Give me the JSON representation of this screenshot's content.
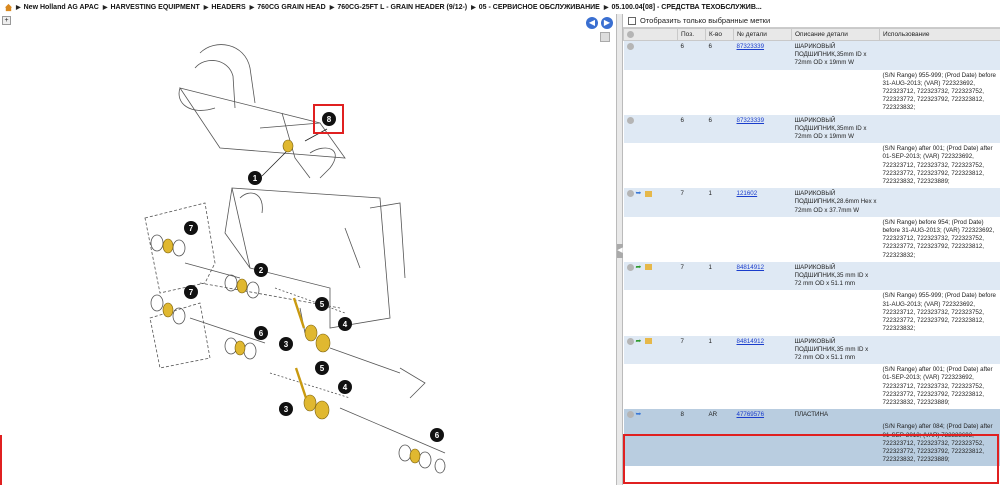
{
  "breadcrumb": [
    "New Holland AG APAC",
    "HARVESTING EQUIPMENT",
    "HEADERS",
    "760CG GRAIN HEAD",
    "760CG-25FT L - GRAIN HEADER (9/12-)",
    "05 - СЕРВИСНОЕ ОБСЛУЖИВАНИЕ",
    "05.100.04[08] - СРЕДСТВА ТЕХОБСЛУЖИВ..."
  ],
  "filter": {
    "label": "Отобразить только выбранные метки"
  },
  "table": {
    "headers": [
      "",
      "Поз.",
      "К-во",
      "№ детали",
      "Описание детали",
      "Использование"
    ],
    "rows": [
      {
        "pos": "6",
        "qty": "6",
        "part": "87323339",
        "desc": "ШАРИКОВЫЙ ПОДШИПНИК,35mm ID x 72mm OD x 19mm W",
        "usage": "(S/N Range) 955-999; (Prod Date) before 31-AUG-2013; (VAR) 722323692, 722323712, 722323732, 722323752, 722323772, 722323792, 722323812, 722323832;",
        "icons": [
          "circle"
        ]
      },
      {
        "pos": "6",
        "qty": "6",
        "part": "87323339",
        "desc": "ШАРИКОВЫЙ ПОДШИПНИК,35mm ID x 72mm OD x 19mm W",
        "usage": "(S/N Range) after 001; (Prod Date) after 01-SEP-2013; (VAR) 722323692, 722323712, 722323732, 722323752, 722323772, 722323792, 722323812, 722323832, 722323889;",
        "icons": [
          "circle"
        ]
      },
      {
        "pos": "7",
        "qty": "1",
        "part": "121602",
        "desc": "ШАРИКОВЫЙ ПОДШИПНИК,28.6mm Hex x 72mm OD x 37.7mm W",
        "usage": "(S/N Range) before 954; (Prod Date) before 31-AUG-2013; (VAR) 722323692, 722323712, 722323732, 722323752, 722323772, 722323792, 722323812, 722323832;",
        "icons": [
          "circle",
          "blue",
          "box"
        ]
      },
      {
        "pos": "7",
        "qty": "1",
        "part": "84814912",
        "desc": "ШАРИКОВЫЙ ПОДШИПНИК,35 mm ID x 72 mm OD x 51.1 mm",
        "usage": "(S/N Range) 955-999; (Prod Date) before 31-AUG-2013; (VAR) 722323692, 722323712, 722323732, 722323752, 722323772, 722323792, 722323812, 722323832;",
        "icons": [
          "circle",
          "green",
          "box"
        ]
      },
      {
        "pos": "7",
        "qty": "1",
        "part": "84814912",
        "desc": "ШАРИКОВЫЙ ПОДШИПНИК,35 mm ID x 72 mm OD x 51.1 mm",
        "usage": "(S/N Range) after 001; (Prod Date) after 01-SEP-2013; (VAR) 722323692, 722323712, 722323732, 722323752, 722323772, 722323792, 722323812, 722323832, 722323889;",
        "icons": [
          "circle",
          "green",
          "box"
        ]
      },
      {
        "pos": "8",
        "qty": "AR",
        "part": "47769576",
        "desc": "ПЛАСТИНА",
        "usage": "(S/N Range) after 084; (Prod Date) after 01-SEP-2013; (VAR) 722323692, 722323712, 722323732, 722323752, 722323772, 722323792, 722323812, 722323832, 722323889;",
        "icons": [
          "circle",
          "blue"
        ],
        "selected": true
      }
    ]
  },
  "callouts": [
    "1",
    "2",
    "3",
    "3",
    "4",
    "4",
    "5",
    "5",
    "6",
    "6",
    "7",
    "7",
    "8"
  ],
  "colors": {
    "accent": "#3a6fd1",
    "highlight": "#e02020",
    "selected_row": "#b9cde0",
    "bearing": "#e0b830"
  }
}
